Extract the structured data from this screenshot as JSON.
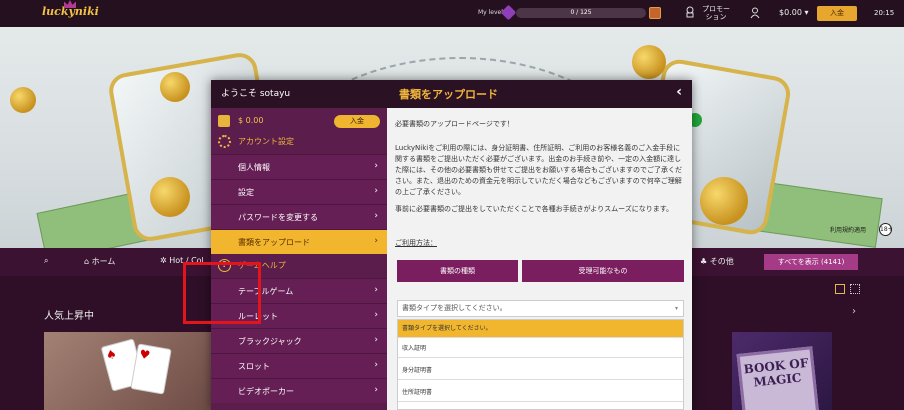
{
  "header": {
    "logo": "luckyniki",
    "level_label": "My level",
    "level_progress": "0 / 125",
    "promo_label": "プロモーション",
    "balance": "$0.00",
    "deposit_label": "入金",
    "time": "20:15"
  },
  "hero": {
    "terms_text": "利用規約適用",
    "age_badge": "18+"
  },
  "nav": {
    "items": [
      "ホーム",
      "Hot / Col",
      "その他"
    ],
    "show_all": "すべてを表示 (4141)"
  },
  "section": {
    "title": "人気上昇中",
    "book_title": "BOOK OF MAGIC"
  },
  "sidebar": {
    "welcome": "ようこそ sotayu",
    "wallet_amount": "$ 0.00",
    "deposit_label": "入金",
    "account_heading": "アカウント設定",
    "account_items": [
      "個人情報",
      "設定",
      "パスワードを変更する",
      "書類をアップロード"
    ],
    "games_heading": "ゲームヘルプ",
    "game_items": [
      "テーブルゲーム",
      "ルーレット",
      "ブラックジャック",
      "スロット",
      "ビデオポーカー"
    ]
  },
  "main": {
    "title": "書類をアップロード",
    "intro": "必要書類のアップロードページです！",
    "body": "LuckyNikiをご利用の際には、身分証明書、住所証明、ご利用のお客様名義のご入金手段に関する書類をご提出いただく必要がございます。出金のお手続き前や、一定の入金額に達した際には、その他の必要書類も併せてご提出をお願いする場合もございますのでご了承ください。また、退出のための資金元を明示していただく場合などもございますので何卒ご理解の上ご了承ください。",
    "note": "事前に必要書類のご提出をしていただくことで各種お手続きがよりスムーズになります。",
    "usage_link": "ご利用方法：",
    "tab_types": "書類の種類",
    "tab_accepted": "受理可能なもの",
    "select_placeholder": "書類タイプを選択してください。",
    "dropdown_options": [
      "書類タイプを選択してください。",
      "収入証明",
      "身分証明書",
      "住所証明書"
    ]
  },
  "colors": {
    "accent": "#f1b62e",
    "sidebar": "#651f54",
    "highlight": "#e3141b"
  }
}
